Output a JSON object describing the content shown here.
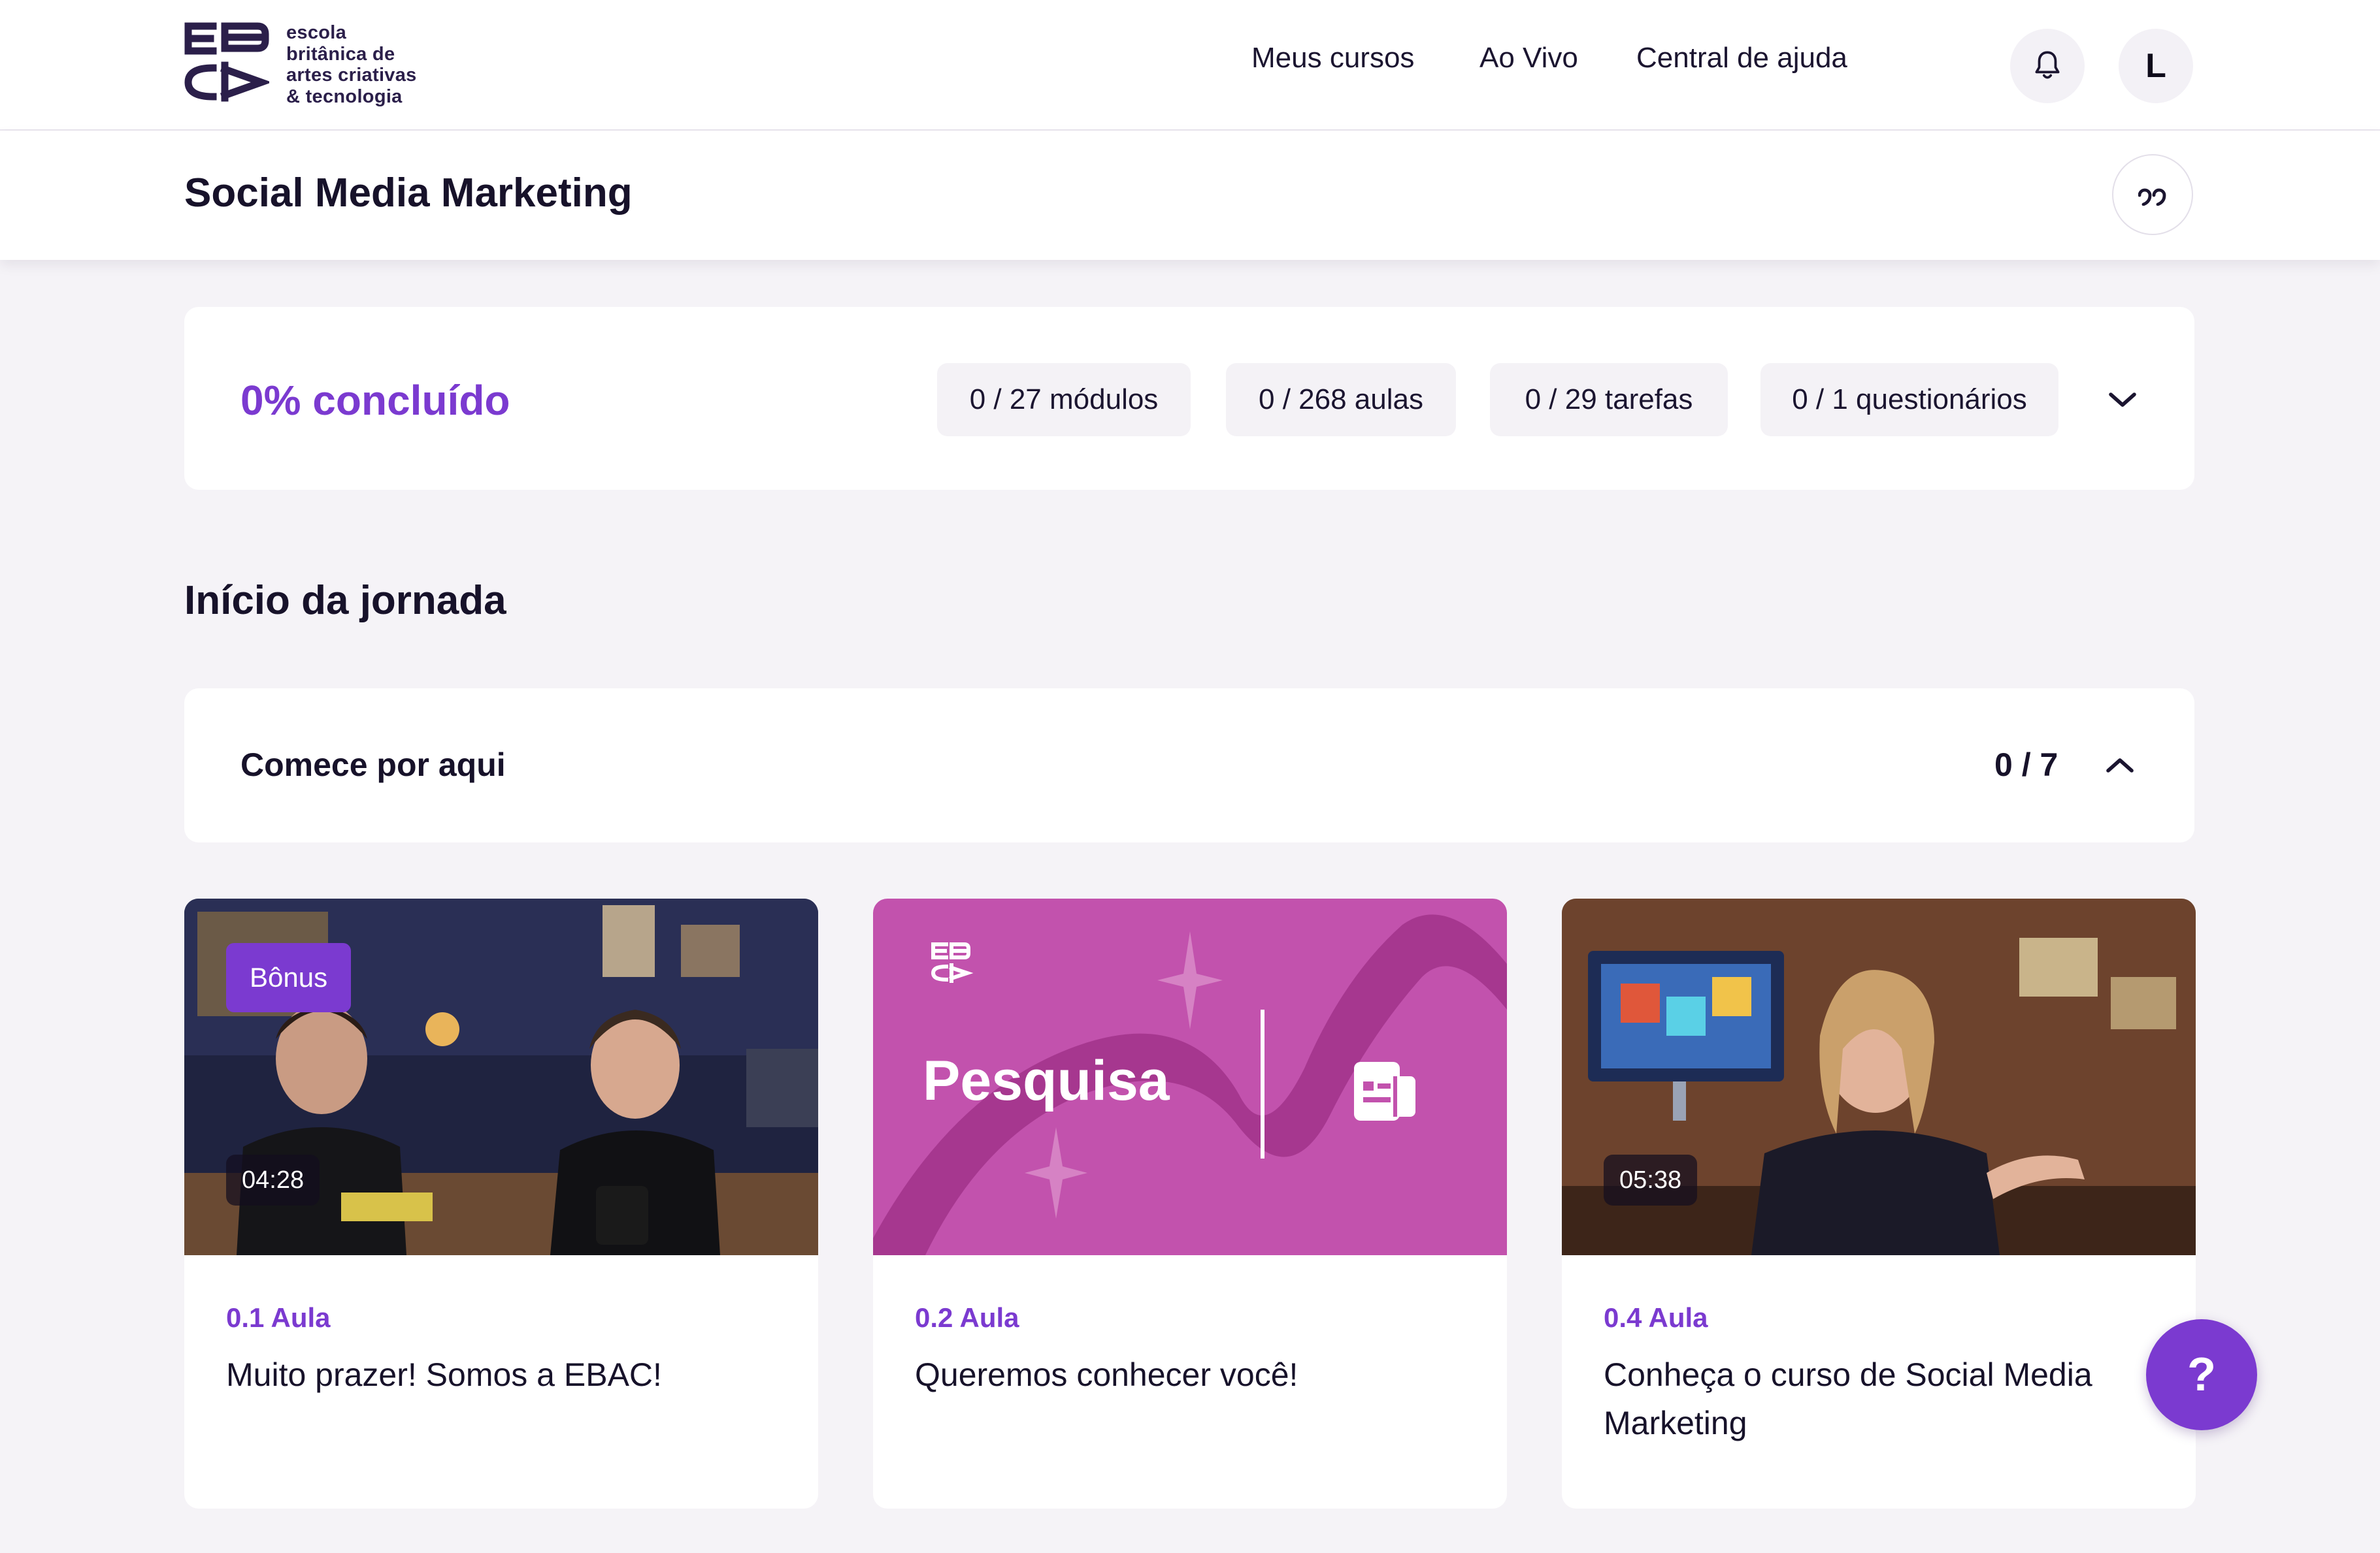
{
  "header": {
    "logo_text_lines": [
      "escola",
      "britânica de",
      "artes criativas",
      "& tecnologia"
    ],
    "nav": [
      "Meus cursos",
      "Ao Vivo",
      "Central de ajuda"
    ],
    "notification_icon": "bell-icon",
    "avatar_letter": "L"
  },
  "course": {
    "title": "Social Media Marketing",
    "quote_icon": "quote-icon"
  },
  "progress": {
    "label": "0% concluído",
    "percent": 0,
    "stats": [
      "0 / 27 módulos",
      "0 / 268 aulas",
      "0 / 29 tarefas",
      "0 / 1 questionários"
    ],
    "expand_icon": "chevron-down-icon"
  },
  "section": {
    "title": "Início da jornada"
  },
  "module": {
    "title": "Comece por aqui",
    "count": "0 / 7",
    "collapse_icon": "chevron-up-icon"
  },
  "lessons": [
    {
      "badge": "Bônus",
      "duration": "04:28",
      "number": "0.1 Aula",
      "title": "Muito prazer! Somos a EBAC!"
    },
    {
      "thumb_label": "Pesquisa",
      "number": "0.2 Aula",
      "title": "Queremos conhecer você!"
    },
    {
      "duration": "05:38",
      "number": "0.4 Aula",
      "title": "Conheça o curso de Social Media Marketing"
    }
  ],
  "help": {
    "label": "?"
  },
  "colors": {
    "accent": "#7b3ad0",
    "pesquisa_bg": "#c252ad"
  }
}
